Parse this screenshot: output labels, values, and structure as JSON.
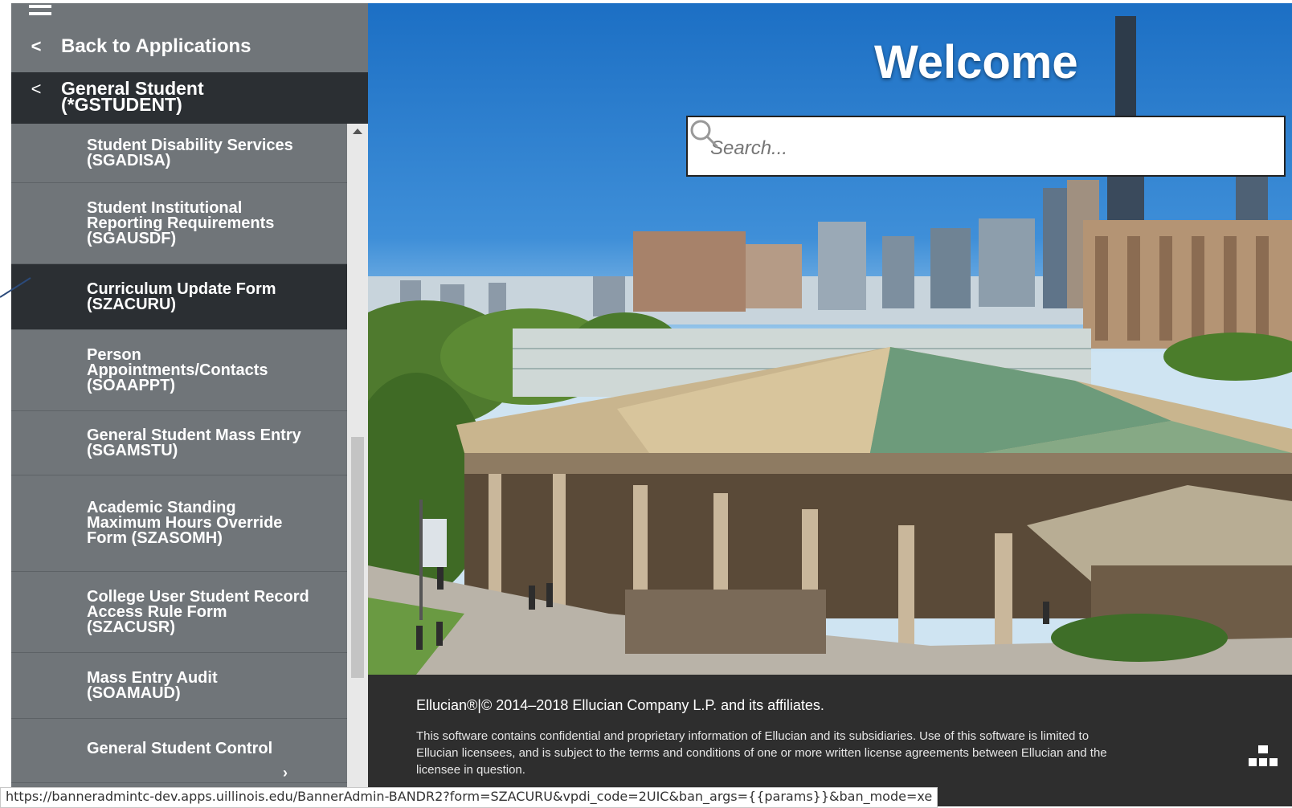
{
  "nav": {
    "back_label": "Back to Applications",
    "current_menu": "General Student (*GSTUDENT)",
    "items": [
      {
        "label": "Student Disability Services (SGADISA)"
      },
      {
        "label": "Student Institutional Reporting Requirements (SGAUSDF)"
      },
      {
        "label": "Curriculum Update Form (SZACURU)",
        "active": true
      },
      {
        "label": "Person Appointments/Contacts (SOAAPPT)"
      },
      {
        "label": "General Student Mass Entry (SGAMSTU)"
      },
      {
        "label": "Academic Standing Maximum Hours Override Form (SZASOMH)"
      },
      {
        "label": "College User Student Record Access Rule Form (SZACUSR)"
      },
      {
        "label": "Mass Entry Audit (SOAMAUD)"
      },
      {
        "label": "General Student Control",
        "has_submenu": true
      }
    ]
  },
  "hero": {
    "welcome": "Welcome",
    "search_placeholder": "Search..."
  },
  "footer": {
    "copyright": "Ellucian®|© 2014–2018 Ellucian Company L.P. and its affiliates.",
    "legal": "This software contains confidential and proprietary information of Ellucian and its subsidiaries. Use of this software is limited to Ellucian licensees, and is subject to the terms and conditions of one or more written license agreements between Ellucian and the licensee in question."
  },
  "status_url": "https://banneradmintc-dev.apps.uillinois.edu/BannerAdmin-BANDR2?form=SZACURU&vpdi_code=2UIC&ban_args={{params}}&ban_mode=xe",
  "colors": {
    "nav_bg": "#707579",
    "nav_active": "#2b2f33",
    "footer_bg": "#2e2e2e"
  },
  "icons": [
    "hamburger-icon",
    "chevron-left-icon",
    "search-icon",
    "sitemap-icon",
    "chevron-right-icon"
  ]
}
